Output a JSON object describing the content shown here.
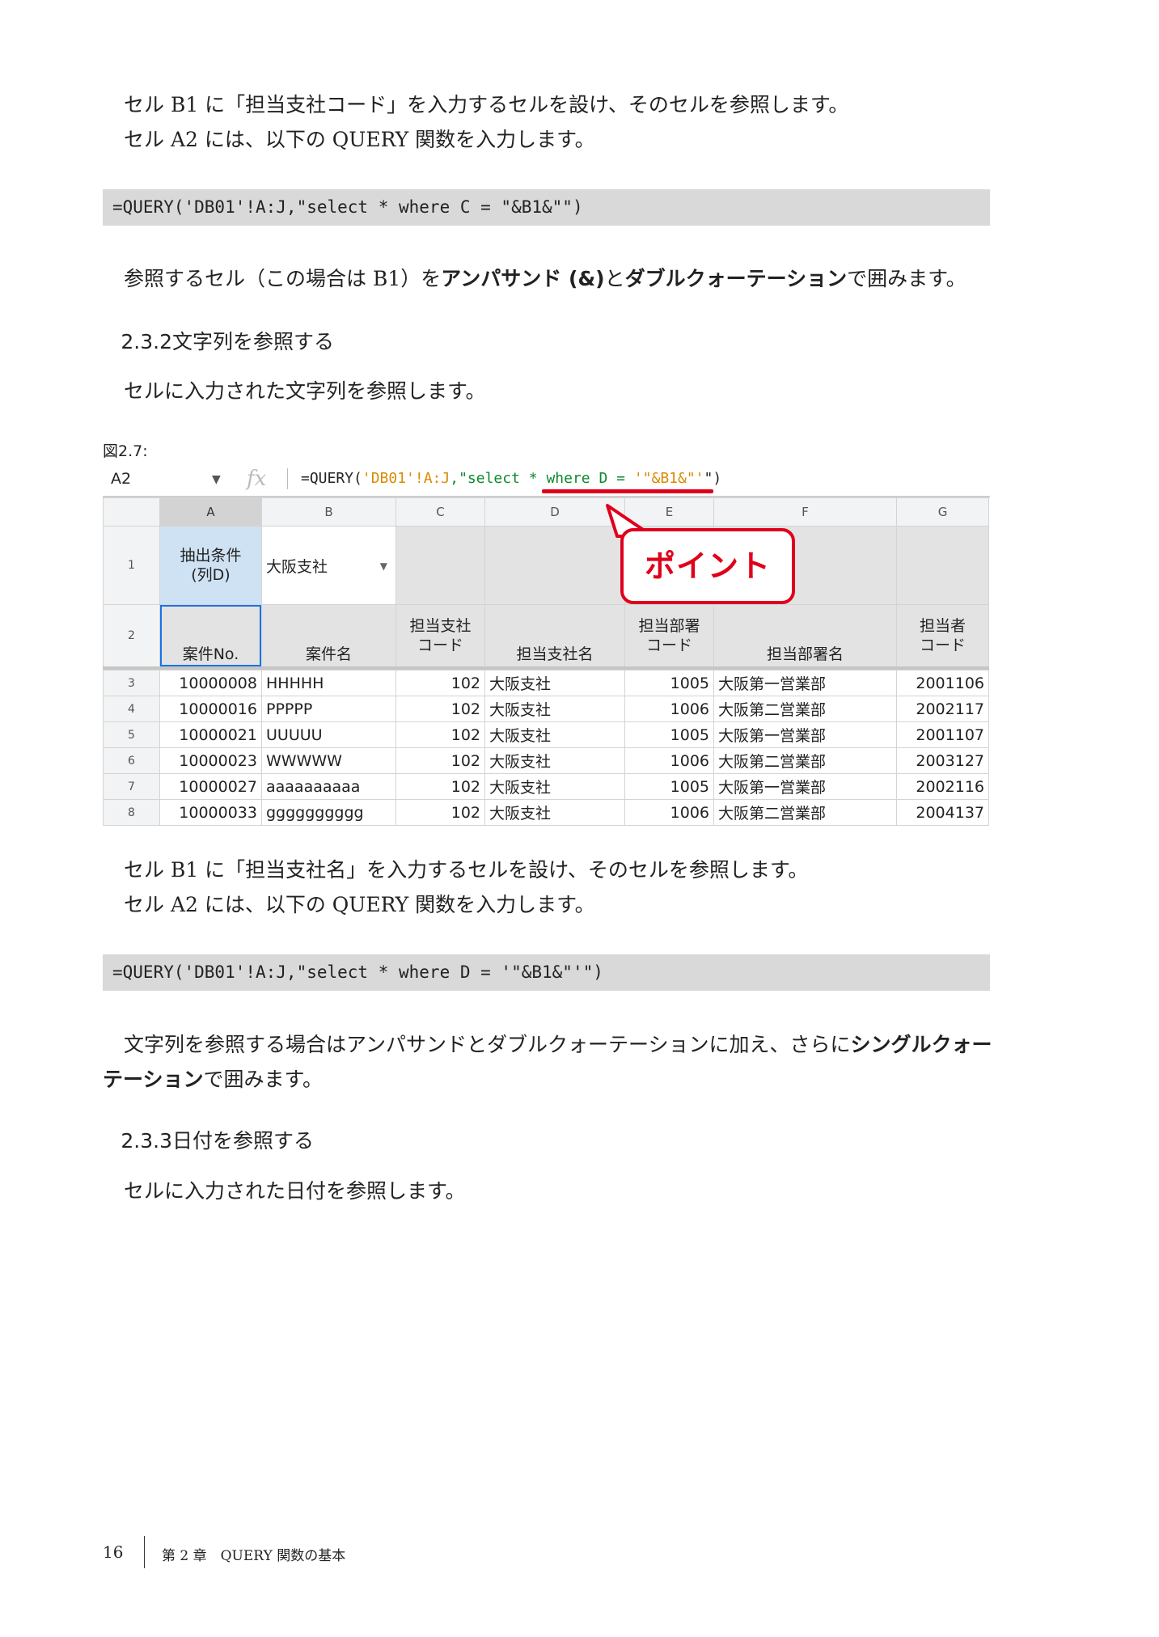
{
  "paragraphs": {
    "p1_line1": "セル B1 に「担当支社コード」を入力するセルを設け、そのセルを参照します。",
    "p1_line2": "セル A2 には、以下の QUERY 関数を入力します。",
    "p2_pre": "参照するセル（この場合は B1）を",
    "p2_b1": "アンパサンド (&)",
    "p2_mid": "と",
    "p2_b2": "ダブルクォーテーション",
    "p2_post": "で囲みます。",
    "p3": "セルに入力された文字列を参照します。",
    "p4_line1": "セル B1 に「担当支社名」を入力するセルを設け、そのセルを参照します。",
    "p4_line2": "セル A2 には、以下の QUERY 関数を入力します。",
    "p5_pre": "文字列を参照する場合はアンパサンドとダブルクォーテーションに加え、さらに",
    "p5_b1": "シングルクォー",
    "p5_b2": "テーション",
    "p5_post": "で囲みます。",
    "p6": "セルに入力された日付を参照します。"
  },
  "code": {
    "c1": "=QUERY('DB01'!A:J,\"select * where C = \"&B1&\"\")",
    "c2": "=QUERY('DB01'!A:J,\"select * where D = '\"&B1&\"'\")"
  },
  "headings": {
    "h1_num": "2.3.2",
    "h1_text": "文字列を参照する",
    "h2_num": "2.3.3",
    "h2_text": "日付を参照する"
  },
  "figure": {
    "caption": "図2.7:",
    "name_box": "A2",
    "fx": "fx",
    "formula_a": "=QUERY(",
    "formula_b": "'DB01'!A:J",
    "formula_c": ",\"select * ",
    "formula_d": "where D = ",
    "formula_e": "'\"&B1&\"'",
    "formula_f": "\")",
    "callout": "ポイント",
    "col_headers": [
      "A",
      "B",
      "C",
      "D",
      "E",
      "F",
      "G"
    ],
    "row1": {
      "num": "1",
      "a_line1": "抽出条件",
      "a_line2": "(列D)",
      "b": "大阪支社"
    },
    "row2": {
      "num": "2",
      "a": "案件No.",
      "b": "案件名",
      "c_line1": "担当支社",
      "c_line2": "コード",
      "d": "担当支社名",
      "e_line1": "担当部署",
      "e_line2": "コード",
      "f": "担当部署名",
      "g_line1": "担当者",
      "g_line2": "コード"
    },
    "rows": [
      {
        "num": "3",
        "a": "10000008",
        "b": "HHHHH",
        "c": "102",
        "d": "大阪支社",
        "e": "1005",
        "f": "大阪第一営業部",
        "g": "2001106"
      },
      {
        "num": "4",
        "a": "10000016",
        "b": "PPPPP",
        "c": "102",
        "d": "大阪支社",
        "e": "1006",
        "f": "大阪第二営業部",
        "g": "2002117"
      },
      {
        "num": "5",
        "a": "10000021",
        "b": "UUUUU",
        "c": "102",
        "d": "大阪支社",
        "e": "1005",
        "f": "大阪第一営業部",
        "g": "2001107"
      },
      {
        "num": "6",
        "a": "10000023",
        "b": "WWWWW",
        "c": "102",
        "d": "大阪支社",
        "e": "1006",
        "f": "大阪第二営業部",
        "g": "2003127"
      },
      {
        "num": "7",
        "a": "10000027",
        "b": "aaaaaaaaaa",
        "c": "102",
        "d": "大阪支社",
        "e": "1005",
        "f": "大阪第一営業部",
        "g": "2002116"
      },
      {
        "num": "8",
        "a": "10000033",
        "b": "gggggggggg",
        "c": "102",
        "d": "大阪支社",
        "e": "1006",
        "f": "大阪第二営業部",
        "g": "2004137"
      }
    ]
  },
  "footer": {
    "page": "16",
    "chapter": "第 2 章　QUERY 関数の基本"
  },
  "colors": {
    "highlight_red": "#e0001b",
    "code_bg": "#d9d9d9",
    "selected_cell": "#cfe2f3"
  }
}
